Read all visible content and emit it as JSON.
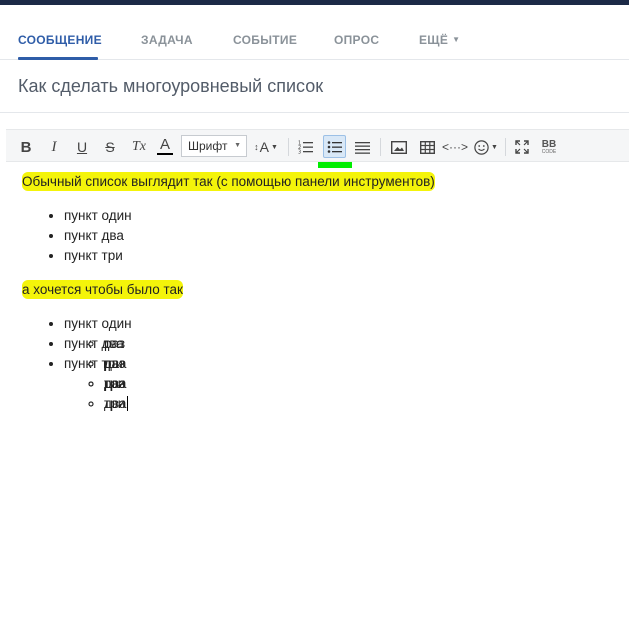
{
  "tabs": [
    {
      "label": "СООБЩЕНИЕ",
      "active": true
    },
    {
      "label": "ЗАДАЧА",
      "active": false
    },
    {
      "label": "СОБЫТИЕ",
      "active": false
    },
    {
      "label": "ОПРОС",
      "active": false
    },
    {
      "label": "ЕЩЁ",
      "active": false
    }
  ],
  "title_input": {
    "value": "Как сделать многоуровневый список"
  },
  "toolbar": {
    "bold_label": "B",
    "italic_label": "I",
    "underline_label": "U",
    "strike_label": "S",
    "clear_format_label": "Tx",
    "font_color_label": "A",
    "font_select_value": "Шрифт",
    "font_size_label": "A",
    "bbcode_label_top": "BB",
    "bbcode_label_bottom": "CODE",
    "active_button": "bulleted-list",
    "accent_color": "#2f5da8",
    "highlight_color": "#f4f40a",
    "marker_color": "#00ee00"
  },
  "editor": {
    "para1": "Обычный список выглядит так (с помощью панели инструментов)",
    "flat_list": [
      "пункт один",
      "пункт два",
      "пункт три"
    ],
    "para2": "а хочется чтобы было так",
    "nested_list": [
      {
        "label": "пункт один",
        "children": [
          "раз",
          "два",
          "три"
        ]
      },
      {
        "label": "пункт два",
        "children": [
          "раз",
          "два",
          "три"
        ]
      },
      {
        "label": "пункт три",
        "children": [
          "раз",
          "два"
        ]
      }
    ]
  }
}
